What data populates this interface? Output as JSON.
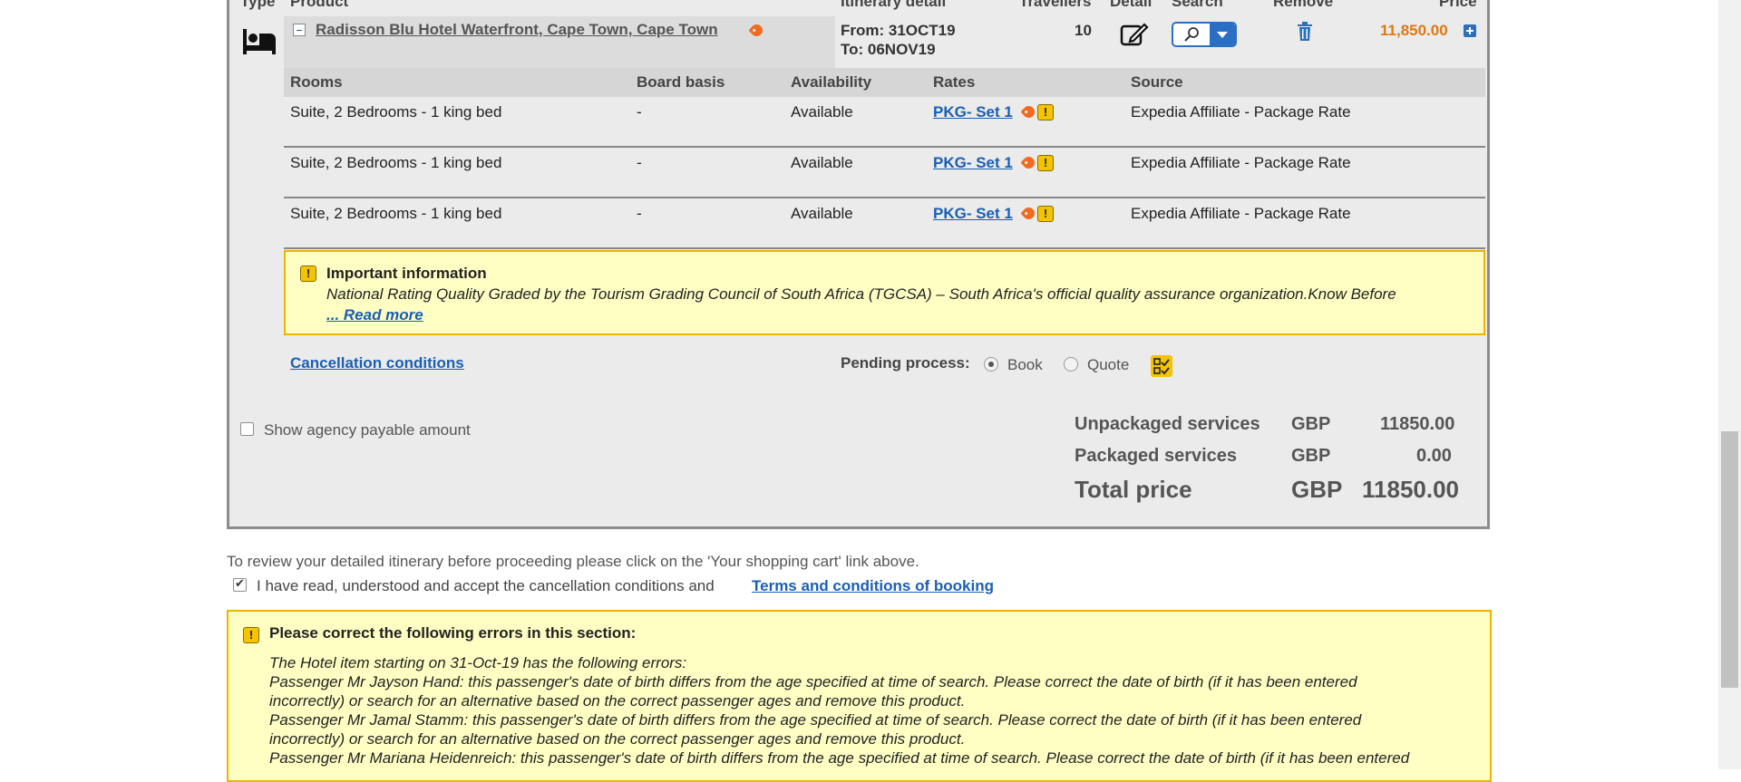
{
  "table_headers": {
    "type": "Type",
    "product": "Product",
    "itinerary": "Itinerary detail",
    "travellers": "Travellers",
    "detail": "Detail",
    "search": "Search",
    "remove": "Remove",
    "price": "Price"
  },
  "hotel": {
    "name": "Radisson Blu Hotel Waterfront, Cape Town, Cape Town",
    "from": "From: 31OCT19",
    "to": "To: 06NOV19",
    "travellers": "10",
    "price": "11,850.00"
  },
  "room_headers": {
    "rooms": "Rooms",
    "board": "Board basis",
    "availability": "Availability",
    "rates": "Rates",
    "source": "Source"
  },
  "rooms": [
    {
      "room": "Suite, 2 Bedrooms - 1 king bed",
      "board": "-",
      "availability": "Available",
      "rate": "PKG- Set 1",
      "source": "Expedia Affiliate - Package Rate"
    },
    {
      "room": "Suite, 2 Bedrooms - 1 king bed",
      "board": "-",
      "availability": "Available",
      "rate": "PKG- Set 1",
      "source": "Expedia Affiliate - Package Rate"
    },
    {
      "room": "Suite, 2 Bedrooms - 1 king bed",
      "board": "-",
      "availability": "Available",
      "rate": "PKG- Set 1",
      "source": "Expedia Affiliate - Package Rate"
    }
  ],
  "important": {
    "title": "Important information",
    "text": "National Rating Quality Graded by the Tourism Grading Council of South Africa (TGCSA) – South Africa's official quality assurance organization.Know Before",
    "read_more": "... Read more"
  },
  "cancellation_link": "Cancellation conditions",
  "pending": {
    "label": "Pending process:",
    "book": "Book",
    "quote": "Quote",
    "selected": "Book"
  },
  "agency_checkbox": {
    "label": "Show agency payable amount",
    "checked": false
  },
  "totals": {
    "unpackaged_label": "Unpackaged services",
    "unpackaged_currency": "GBP",
    "unpackaged_value": "11850.00",
    "packaged_label": "Packaged services",
    "packaged_currency": "GBP",
    "packaged_value": "0.00",
    "total_label": "Total price",
    "total_currency": "GBP",
    "total_value": "11850.00"
  },
  "review_note": "To review your detailed itinerary before proceeding please click on the 'Your shopping cart' link above.",
  "accept": {
    "label": "I have read, understood and accept the cancellation conditions and",
    "link": "Terms and conditions of booking",
    "checked": true
  },
  "errors": {
    "title": "Please correct the following errors in this section:",
    "lines": [
      "The Hotel item starting on 31-Oct-19 has the following errors:",
      "Passenger Mr Jayson Hand: this passenger's date of birth differs from the age specified at time of search. Please correct the date of birth (if it has been entered",
      "incorrectly) or search for an alternative based on the correct passenger ages and remove this product.",
      "Passenger Mr Jamal Stamm: this passenger's date of birth differs from the age specified at time of search. Please correct the date of birth (if it has been entered",
      "incorrectly) or search for an alternative based on the correct passenger ages and remove this product.",
      "Passenger Mr Mariana Heidenreich: this passenger's date of birth differs from the age specified at time of search. Please correct the date of birth (if it has been entered"
    ]
  },
  "colors": {
    "accent": "#1a5fb4",
    "price": "#e07812",
    "warning_bg": "#ffffc4",
    "warning_border": "#f2b200"
  }
}
